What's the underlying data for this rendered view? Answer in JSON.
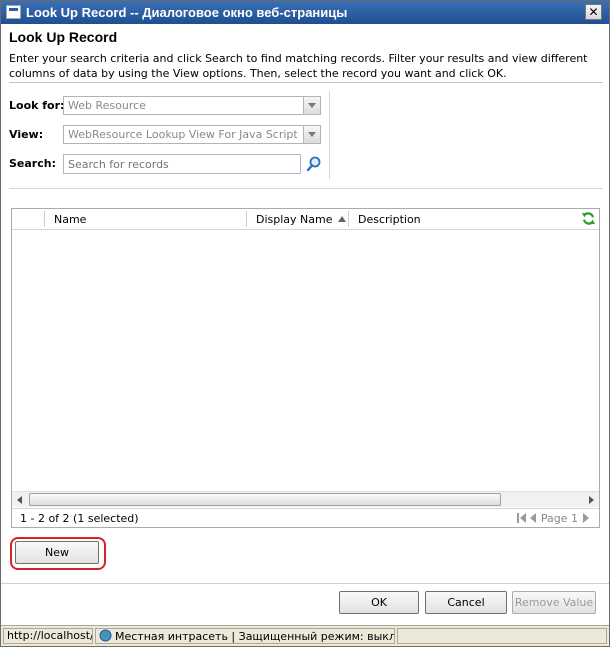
{
  "window": {
    "title": "Look Up Record -- Диалоговое окно веб-страницы",
    "close_glyph": "✕"
  },
  "header": {
    "title": "Look Up Record",
    "description": "Enter your search criteria and click Search to find matching records. Filter your results and view different columns of data by using the View options. Then, select the record you want and click OK."
  },
  "criteria": {
    "look_for_label": "Look for:",
    "look_for_value": "Web Resource",
    "view_label": "View:",
    "view_value": "WebResource Lookup View For Java Script Lib",
    "search_label": "Search:",
    "search_placeholder": "Search for records"
  },
  "grid": {
    "columns": [
      "Name",
      "Display Name",
      "Description"
    ],
    "sorted_column": "Display Name",
    "sort_direction": "ascending",
    "rows": [],
    "count_text": "1 - 2 of 2 (1 selected)",
    "pager_text": "Page 1"
  },
  "buttons": {
    "new": "New",
    "ok": "OK",
    "cancel": "Cancel",
    "remove_value": "Remove Value"
  },
  "status": {
    "url": "http://localhost/D",
    "zone": "Местная интрасеть | Защищенный режим: выкл."
  },
  "colors": {
    "title_bar": "#1f4f92",
    "highlight_ring": "#d9202a",
    "refresh_icon": "#2e9b2e",
    "search_icon": "#2a6fc2"
  },
  "icons": {
    "refresh": "refresh-icon",
    "search": "magnifier-icon",
    "zone": "globe-icon"
  }
}
